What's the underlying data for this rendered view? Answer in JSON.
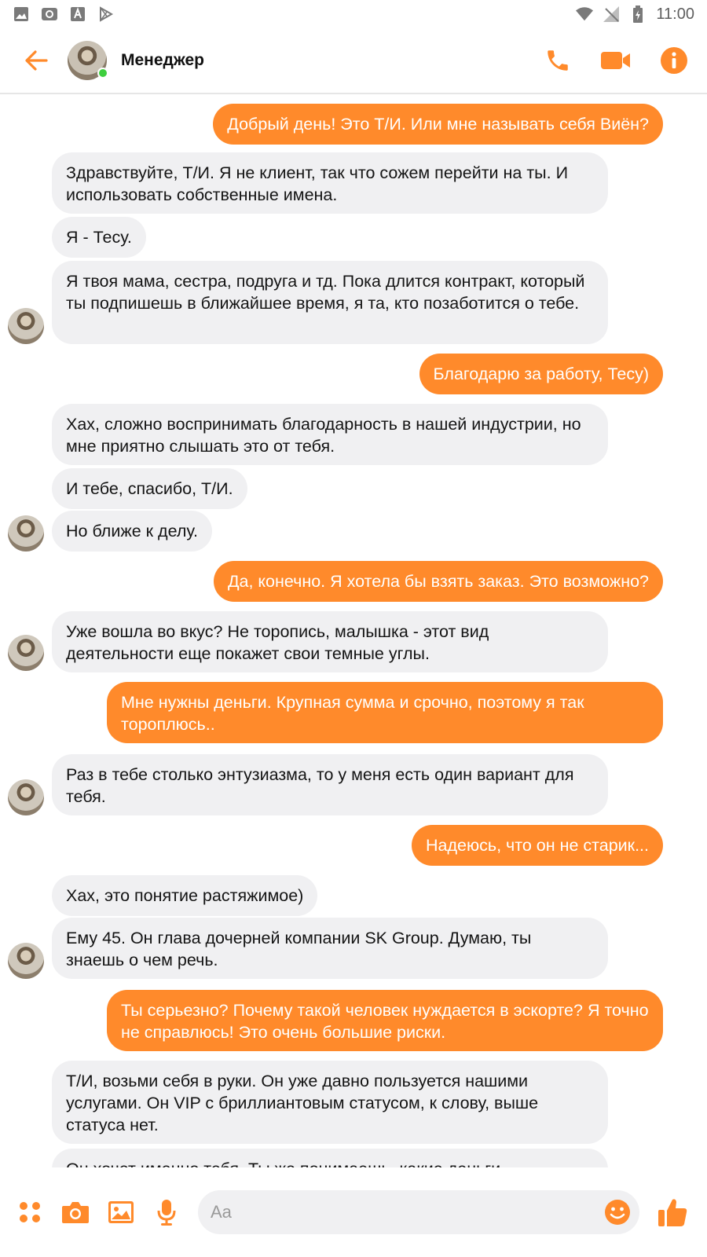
{
  "status_bar": {
    "time": "11:00",
    "left_icons": [
      "image-icon",
      "alarm-icon",
      "font-icon",
      "play-store-icon"
    ],
    "right_icons": [
      "wifi-icon",
      "no-signal-icon",
      "battery-icon"
    ]
  },
  "header": {
    "contact_name": "Менеджер",
    "online": true,
    "actions": [
      "phone-icon",
      "video-icon",
      "info-icon"
    ]
  },
  "colors": {
    "accent": "#ff8a2b",
    "incoming_bubble": "#f0f0f2",
    "online": "#3ecf3e"
  },
  "messages": [
    {
      "dir": "out",
      "text": "Добрый день! Это Т/И. Или мне называть себя Виён?"
    },
    {
      "dir": "in",
      "text": "Здравствуйте, Т/И. Я не клиент, так что сожем перейти на ты. И использовать собственные имена."
    },
    {
      "dir": "in",
      "text": "Я - Тесу."
    },
    {
      "dir": "in",
      "text": "Я твоя мама, сестра, подруга и тд. Пока длится контракт, который ты подпишешь в ближайшее время, я та, кто позаботится о тебе."
    },
    {
      "dir": "out",
      "text": "Благодарю за работу, Тесу)"
    },
    {
      "dir": "in",
      "text": "Хах, сложно воспринимать благодарность в нашей индустрии, но мне приятно слышать это от тебя."
    },
    {
      "dir": "in",
      "text": "И тебе, спасибо, Т/И."
    },
    {
      "dir": "in",
      "text": "Но ближе к делу."
    },
    {
      "dir": "out",
      "text": "Да, конечно. Я хотела бы взять заказ. Это возможно?"
    },
    {
      "dir": "in",
      "text": "Уже вошла во вкус? Не торопись, малышка - этот вид деятельности еще покажет свои темные углы."
    },
    {
      "dir": "out",
      "text": "Мне нужны деньги. Крупная сумма и срочно, поэтому я так тороплюсь.."
    },
    {
      "dir": "in",
      "text": "Раз в тебе столько энтузиазма, то у меня есть один вариант для тебя."
    },
    {
      "dir": "out",
      "text": "Надеюсь, что он не старик..."
    },
    {
      "dir": "in",
      "text": "Хах, это понятие растяжимое)"
    },
    {
      "dir": "in",
      "text": "Ему 45. Он глава дочерней компании SK Group. Думаю, ты знаешь о чем речь."
    },
    {
      "dir": "out",
      "text": "Ты серьезно? Почему такой человек нуждается в эскорте? Я точно не справлюсь! Это очень большие риски."
    },
    {
      "dir": "in",
      "text": "Т/И, возьми себя в руки. Он уже давно пользуется нашими услугами. Он VIP с бриллиантовым статусом, к слову, выше статуса нет."
    },
    {
      "dir": "in",
      "text": "Он хочет именно тебя. Ты же понимаешь, какие деньги"
    }
  ],
  "composer": {
    "placeholder": "Aa",
    "left_icons": [
      "apps-icon",
      "camera-icon",
      "gallery-icon",
      "microphone-icon"
    ],
    "emoji_icon": "emoji-icon",
    "send_icon": "thumbs-up-icon"
  }
}
